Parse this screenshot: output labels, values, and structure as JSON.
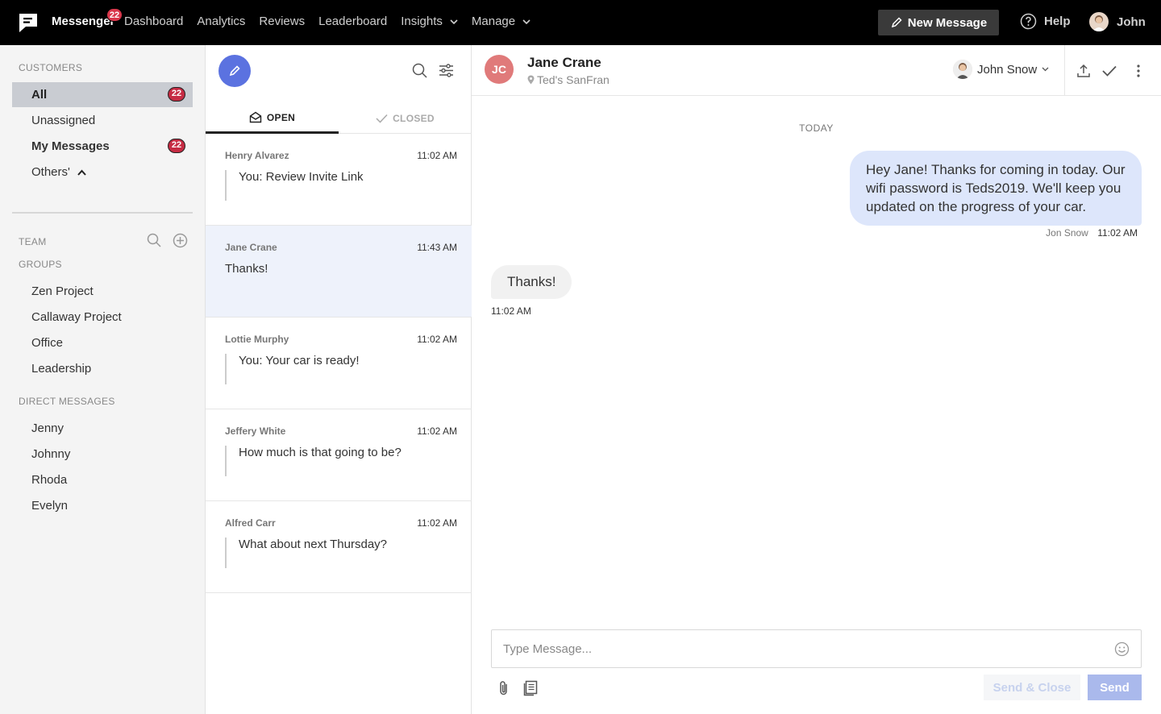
{
  "topbar": {
    "brand": "Messenger",
    "brand_badge": "22",
    "nav": [
      "Dashboard",
      "Analytics",
      "Reviews",
      "Leaderboard",
      "Insights",
      "Manage"
    ],
    "new_message": "New Message",
    "help": "Help",
    "user": "John"
  },
  "sidebar": {
    "customers_title": "CUSTOMERS",
    "all": "All",
    "all_count": "22",
    "unassigned": "Unassigned",
    "my_messages": "My Messages",
    "my_count": "22",
    "others": "Others'",
    "team_title": "TEAM",
    "groups_title": "GROUPS",
    "groups": [
      "Zen Project",
      "Callaway Project",
      "Office",
      "Leadership"
    ],
    "dm_title": "DIRECT MESSAGES",
    "dms": [
      "Jenny",
      "Johnny",
      "Rhoda",
      "Evelyn"
    ]
  },
  "convlist": {
    "tab_open": "OPEN",
    "tab_closed": "CLOSED",
    "items": [
      {
        "name": "Henry Alvarez",
        "time": "11:02 AM",
        "snippet": "You: Review Invite Link"
      },
      {
        "name": "Jane Crane",
        "time": "11:43 AM",
        "snippet": "Thanks!"
      },
      {
        "name": "Lottie Murphy",
        "time": "11:02 AM",
        "snippet": "You: Your car is ready!"
      },
      {
        "name": "Jeffery White",
        "time": "11:02 AM",
        "snippet": "How much is that going to be?"
      },
      {
        "name": "Alfred Carr",
        "time": "11:02 AM",
        "snippet": "What about next Thursday?"
      }
    ]
  },
  "chat": {
    "initials": "JC",
    "contact_name": "Jane Crane",
    "location": "Ted's SanFran",
    "assignee": "John Snow",
    "day": "TODAY",
    "outgoing": "Hey Jane! Thanks for coming in today. Our wifi password is Teds2019. We'll keep you updated on the progress of your car.",
    "outgoing_author": "Jon Snow",
    "outgoing_time": "11:02 AM",
    "incoming": "Thanks!",
    "incoming_time": "11:02 AM",
    "placeholder": "Type Message...",
    "send_close": "Send & Close",
    "send": "Send"
  }
}
